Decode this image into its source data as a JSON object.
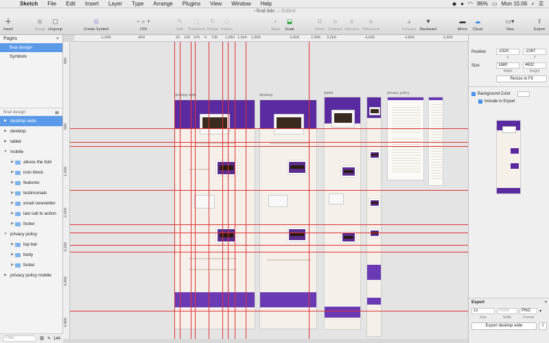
{
  "menubar": {
    "app": "Sketch",
    "items": [
      "File",
      "Edit",
      "Insert",
      "Layer",
      "Type",
      "Arrange",
      "Plugins",
      "View",
      "Window",
      "Help"
    ],
    "battery": "96%",
    "clock": "Mon 15:06"
  },
  "window": {
    "title": "final tido",
    "status": "— Edited"
  },
  "toolbar": {
    "insert": "Insert",
    "group": "Group",
    "ungroup": "Ungroup",
    "create_symbol": "Create Symbol",
    "zoom": "13%",
    "edit": "Edit",
    "transform": "Transform",
    "rotate": "Rotate",
    "flatten": "Flatten",
    "mask": "Mask",
    "scale": "Scale",
    "union": "Union",
    "subtract": "Subtract",
    "intersect": "Intersect",
    "difference": "Difference",
    "forward": "Forward",
    "backward": "Backward",
    "mirror": "Mirror",
    "cloud": "Cloud",
    "view": "View",
    "export": "Export"
  },
  "hruler": [
    "-1,600",
    "-800",
    "20",
    "120",
    "376",
    "0",
    "730",
    "1,050",
    "1,504",
    "1,800",
    "2,400",
    "2,838",
    "3,200",
    "4,000",
    "4,800",
    "5,600"
  ],
  "vruler": [
    "800",
    "600",
    "1,600",
    "2,400",
    "3,200",
    "4,000",
    "4,800"
  ],
  "pages": {
    "title": "Pages",
    "items": [
      {
        "label": "final design",
        "selected": true
      },
      {
        "label": "Symbols",
        "selected": false
      }
    ]
  },
  "layers_title": "final design",
  "layers": [
    {
      "label": "desktop wide",
      "indent": 0,
      "folder": false,
      "open": false,
      "selected": true
    },
    {
      "label": "desktop",
      "indent": 0,
      "folder": false,
      "open": false,
      "selected": false
    },
    {
      "label": "tablet",
      "indent": 0,
      "folder": false,
      "open": false,
      "selected": false
    },
    {
      "label": "mobile",
      "indent": 0,
      "folder": false,
      "open": true,
      "selected": false
    },
    {
      "label": "above the fold",
      "indent": 1,
      "folder": true,
      "open": false,
      "selected": false
    },
    {
      "label": "icon block",
      "indent": 1,
      "folder": true,
      "open": false,
      "selected": false
    },
    {
      "label": "features",
      "indent": 1,
      "folder": true,
      "open": false,
      "selected": false
    },
    {
      "label": "testimonials",
      "indent": 1,
      "folder": true,
      "open": false,
      "selected": false
    },
    {
      "label": "email newsletter",
      "indent": 1,
      "folder": true,
      "open": false,
      "selected": false
    },
    {
      "label": "last call to action",
      "indent": 1,
      "folder": true,
      "open": false,
      "selected": false
    },
    {
      "label": "footer",
      "indent": 1,
      "folder": true,
      "open": false,
      "selected": false
    },
    {
      "label": "privacy policy",
      "indent": 0,
      "folder": false,
      "open": true,
      "selected": false
    },
    {
      "label": "top bar",
      "indent": 1,
      "folder": true,
      "open": false,
      "selected": false
    },
    {
      "label": "body",
      "indent": 1,
      "folder": true,
      "open": false,
      "selected": false
    },
    {
      "label": "footer",
      "indent": 1,
      "folder": true,
      "open": false,
      "selected": false
    },
    {
      "label": "privacy policy mobile",
      "indent": 0,
      "folder": false,
      "open": false,
      "selected": false
    }
  ],
  "left_footer": {
    "filter_placeholder": "Filter",
    "count": "144"
  },
  "artboards": {
    "desktop_wide": "desktop wide",
    "desktop": "desktop",
    "tablet": "tablet",
    "privacy": "privacy policy"
  },
  "inspector": {
    "position_label": "Position",
    "pos_x": "-2320",
    "pos_y": "-2267",
    "x_label": "X",
    "y_label": "Y",
    "size_label": "Size",
    "width": "1680",
    "height": "4632",
    "width_label": "Width",
    "height_label": "Height",
    "resize_button": "Resize to Fit",
    "background_color_label": "Background Color",
    "include_export_label": "Include in Export",
    "export_title": "Export",
    "export_scale": "1x",
    "export_suffix_placeholder": "Prefix",
    "export_format": "PNG",
    "size_col": "Size",
    "suffix_col": "Suffix",
    "format_col": "Format",
    "export_button": "Export desktop wide"
  },
  "colors": {
    "accent": "#5b9ae8",
    "guide": "#e03030",
    "brand_purple": "#5a2aa0",
    "artboard_bg": "#f5f1ea"
  }
}
